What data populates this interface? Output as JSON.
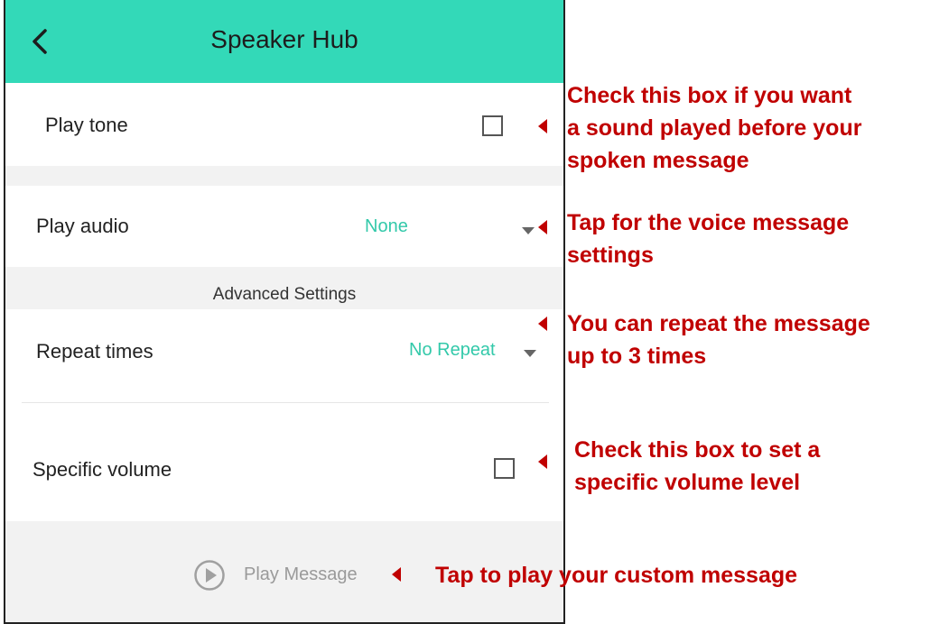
{
  "header": {
    "title": "Speaker Hub"
  },
  "settings": {
    "play_tone": {
      "label": "Play tone",
      "checked": false
    },
    "play_audio": {
      "label": "Play audio",
      "value": "None"
    },
    "advanced_caption": "Advanced Settings",
    "repeat_times": {
      "label": "Repeat times",
      "value": "No Repeat"
    },
    "specific_volume": {
      "label": "Specific volume",
      "checked": false
    }
  },
  "play_message": {
    "label": "Play Message"
  },
  "annotations": {
    "play_tone_note": {
      "line1": "Check this box if you want",
      "line2": "a sound played before your",
      "line3": "spoken message"
    },
    "play_audio_note": {
      "line1": "Tap for the voice message",
      "line2": "settings"
    },
    "repeat_note": {
      "line1": "You can repeat the message",
      "line2": "up to 3 times"
    },
    "volume_note": {
      "line1": "Check this box to set a",
      "line2": "specific volume level"
    },
    "play_message_note": {
      "line1": "Tap to play your custom message"
    }
  },
  "colors": {
    "header": "#33d9b8",
    "accent_value": "#33c9aa",
    "annotation": "#c00000",
    "background": "#f2f2f2"
  },
  "icons": {
    "back": "chevron-left-icon",
    "play": "play-circle-icon",
    "dropdown": "caret-down-icon"
  }
}
